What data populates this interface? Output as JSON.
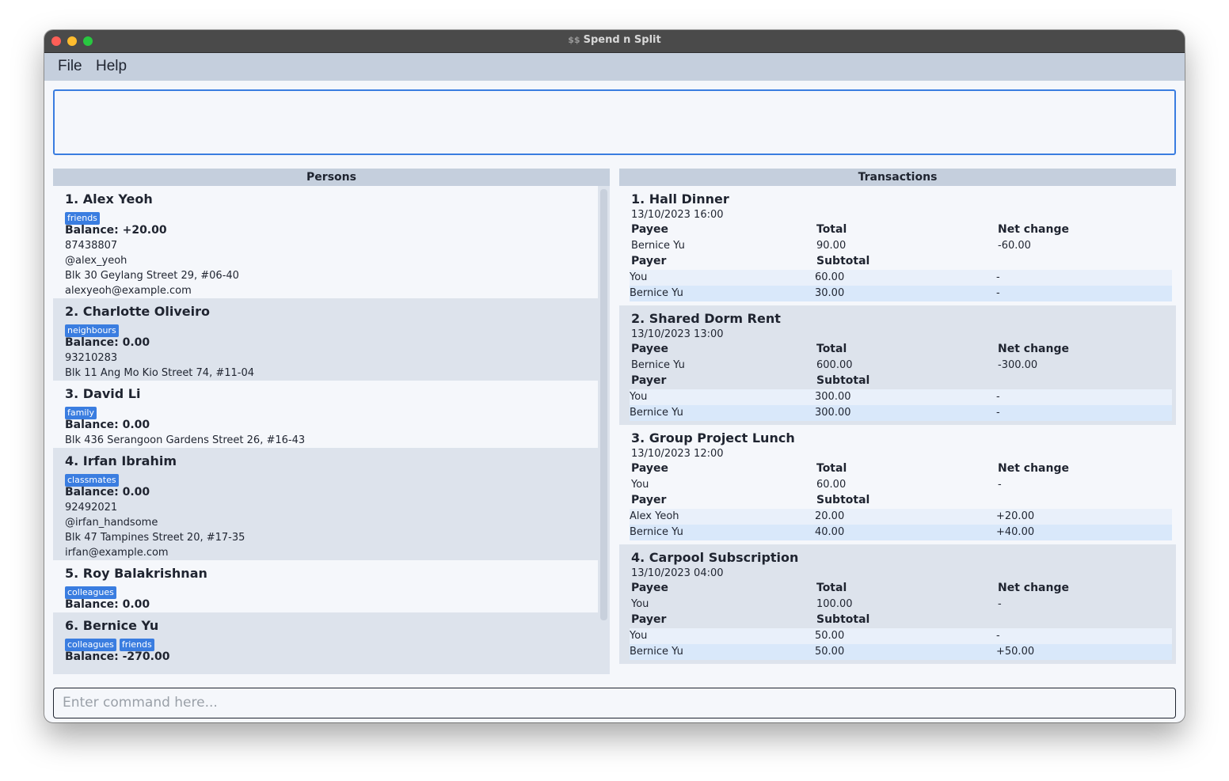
{
  "window": {
    "title": "Spend n Split",
    "title_icon": "$$"
  },
  "menu": {
    "file": "File",
    "help": "Help"
  },
  "result_display": "",
  "persons": {
    "header": "Persons",
    "items": [
      {
        "name": "1.  Alex Yeoh",
        "tags": [
          "friends"
        ],
        "balance": "Balance: +20.00",
        "details": [
          "87438807",
          "@alex_yeoh",
          "Blk 30 Geylang Street 29, #06-40",
          "alexyeoh@example.com"
        ]
      },
      {
        "name": "2.  Charlotte Oliveiro",
        "tags": [
          "neighbours"
        ],
        "balance": "Balance: 0.00",
        "details": [
          "93210283",
          "Blk 11 Ang Mo Kio Street 74, #11-04"
        ]
      },
      {
        "name": "3.  David Li",
        "tags": [
          "family"
        ],
        "balance": "Balance: 0.00",
        "details": [
          "Blk 436 Serangoon Gardens Street 26, #16-43"
        ]
      },
      {
        "name": "4.  Irfan Ibrahim",
        "tags": [
          "classmates"
        ],
        "balance": "Balance: 0.00",
        "details": [
          "92492021",
          "@irfan_handsome",
          "Blk 47 Tampines Street 20, #17-35",
          "irfan@example.com"
        ]
      },
      {
        "name": "5.  Roy Balakrishnan",
        "tags": [
          "colleagues"
        ],
        "balance": "Balance: 0.00",
        "details": []
      },
      {
        "name": "6.  Bernice Yu",
        "tags": [
          "colleagues",
          "friends"
        ],
        "balance": "Balance: -270.00",
        "details": []
      }
    ]
  },
  "transactions": {
    "header": "Transactions",
    "labels": {
      "payee": "Payee",
      "total": "Total",
      "net_change": "Net change",
      "payer": "Payer",
      "subtotal": "Subtotal"
    },
    "items": [
      {
        "name": "1.  Hall Dinner",
        "date": "13/10/2023 16:00",
        "payee": {
          "name": "Bernice Yu",
          "total": "90.00",
          "net": "-60.00"
        },
        "payers": [
          {
            "name": "You",
            "subtotal": "60.00",
            "net": "-"
          },
          {
            "name": "Bernice Yu",
            "subtotal": "30.00",
            "net": "-"
          }
        ]
      },
      {
        "name": "2.  Shared Dorm Rent",
        "date": "13/10/2023 13:00",
        "payee": {
          "name": "Bernice Yu",
          "total": "600.00",
          "net": "-300.00"
        },
        "payers": [
          {
            "name": "You",
            "subtotal": "300.00",
            "net": "-"
          },
          {
            "name": "Bernice Yu",
            "subtotal": "300.00",
            "net": "-"
          }
        ]
      },
      {
        "name": "3.  Group Project Lunch",
        "date": "13/10/2023 12:00",
        "payee": {
          "name": "You",
          "total": "60.00",
          "net": "-"
        },
        "payers": [
          {
            "name": "Alex Yeoh",
            "subtotal": "20.00",
            "net": "+20.00"
          },
          {
            "name": "Bernice Yu",
            "subtotal": "40.00",
            "net": "+40.00"
          }
        ]
      },
      {
        "name": "4.  Carpool Subscription",
        "date": "13/10/2023 04:00",
        "payee": {
          "name": "You",
          "total": "100.00",
          "net": "-"
        },
        "payers": [
          {
            "name": "You",
            "subtotal": "50.00",
            "net": "-"
          },
          {
            "name": "Bernice Yu",
            "subtotal": "50.00",
            "net": "+50.00"
          }
        ]
      }
    ]
  },
  "command": {
    "placeholder": "Enter command here..."
  }
}
